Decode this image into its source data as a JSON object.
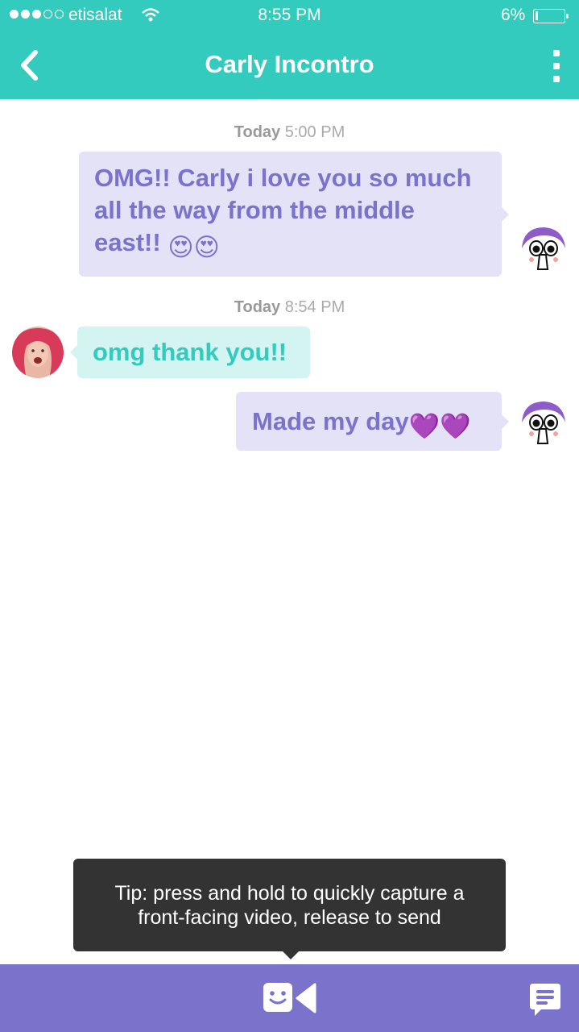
{
  "status_bar": {
    "carrier": "etisalat",
    "time": "8:55 PM",
    "battery_percent": "6%",
    "battery_level": 0.06,
    "signal_bars_filled": 3,
    "signal_bars_total": 5
  },
  "header": {
    "title": "Carly Incontro",
    "back_icon": "chevron-left-icon",
    "more_icon": "vertical-dots-icon"
  },
  "conversation": {
    "groups": [
      {
        "day": "Today",
        "time": "5:00 PM"
      },
      {
        "day": "Today",
        "time": "8:54 PM"
      }
    ],
    "messages": [
      {
        "sender": "me",
        "text": "OMG!! Carly i love you so much all the way from the middle east!!",
        "emoji": "😍😍"
      },
      {
        "sender": "them",
        "text": "omg thank you!!",
        "emoji": ""
      },
      {
        "sender": "me",
        "text": "Made my day",
        "emoji": "💜💜"
      }
    ]
  },
  "tip": {
    "text": "Tip: press and hold to quickly capture a front-facing video, release to send"
  },
  "bottom_bar": {
    "video_icon": "video-camera-smile-icon",
    "chat_icon": "chat-bubble-icon"
  },
  "colors": {
    "teal": "#33cbbd",
    "purple": "#7b72cc",
    "my_bubble": "#e4e2f6",
    "their_bubble": "#d3f4f1",
    "tip_background": "#333333"
  }
}
